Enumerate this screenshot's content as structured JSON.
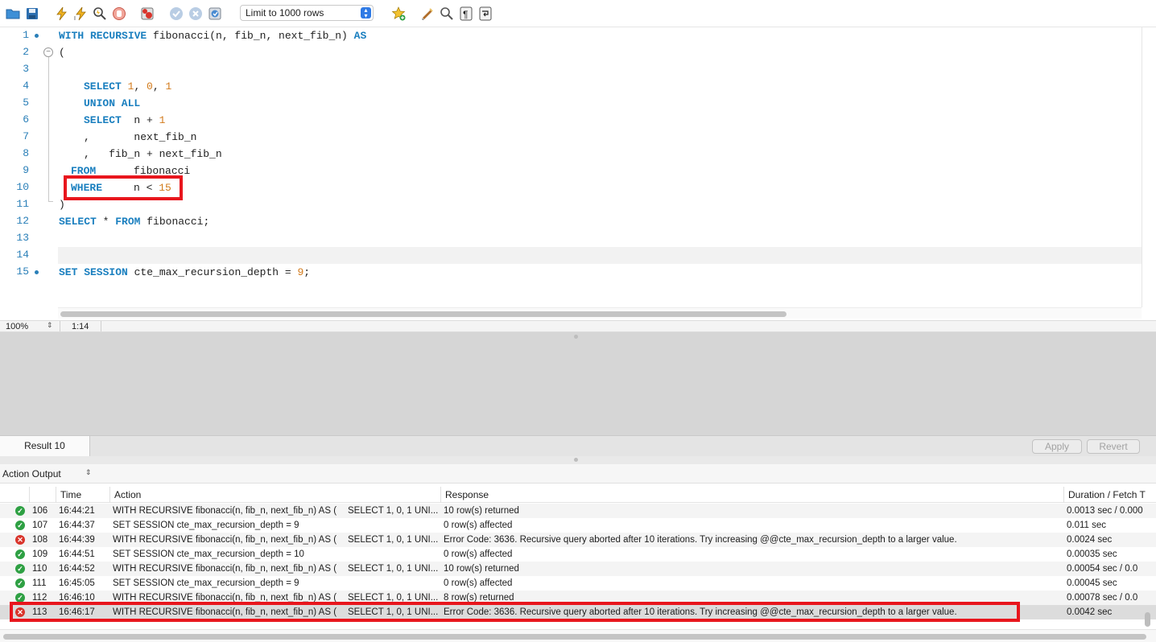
{
  "toolbar": {
    "icons": [
      "open-folder-icon",
      "save-icon",
      "execute-icon",
      "execute-current-icon",
      "explain-icon",
      "stop-icon",
      "toggle-error-icon",
      "commit-icon",
      "rollback-icon",
      "autocommit-icon",
      "add-snippet-icon",
      "beautify-icon",
      "find-icon",
      "invisible-chars-icon",
      "wrap-icon"
    ],
    "limit_label": "Limit to 1000 rows"
  },
  "editor": {
    "line_numbers": [
      "1",
      "2",
      "3",
      "4",
      "5",
      "6",
      "7",
      "8",
      "9",
      "10",
      "11",
      "12",
      "13",
      "14",
      "15"
    ],
    "lines": {
      "l1": {
        "kw1": "WITH RECURSIVE",
        "t1": " fibonacci(n, fib_n, next_fib_n) ",
        "kw2": "AS"
      },
      "l2": {
        "t1": "("
      },
      "l4": {
        "kw1": "SELECT",
        "n1": "1",
        "c1": ", ",
        "n2": "0",
        "c2": ", ",
        "n3": "1"
      },
      "l5": {
        "kw1": "UNION ALL"
      },
      "l6": {
        "kw1": "SELECT",
        "t1": "  n + ",
        "n1": "1"
      },
      "l7": {
        "t1": ",       next_fib_n"
      },
      "l8": {
        "t1": ",   fib_n + next_fib_n"
      },
      "l9": {
        "kw1": "FROM",
        "t1": "      fibonacci"
      },
      "l10": {
        "kw1": "WHERE",
        "t1": "     n < ",
        "n1": "15"
      },
      "l11": {
        "t1": ")"
      },
      "l12": {
        "kw1": "SELECT",
        "t1": " * ",
        "kw2": "FROM",
        "t2": " fibonacci;"
      },
      "l15": {
        "kw1": "SET SESSION",
        "t1": " cte_max_recursion_depth = ",
        "n1": "9",
        "t2": ";"
      }
    }
  },
  "status_bar": {
    "zoom": "100%",
    "cursor_position": "1:14"
  },
  "result_tabs": {
    "active_tab": "Result 10",
    "apply_label": "Apply",
    "revert_label": "Revert"
  },
  "output": {
    "selector_label": "Action Output",
    "columns": [
      "",
      "",
      "Time",
      "Action",
      "Response",
      "Duration / Fetch T"
    ],
    "rows": [
      {
        "status": "ok",
        "num": "106",
        "time": "16:44:21",
        "action": "WITH RECURSIVE fibonacci(n, fib_n, next_fib_n) AS (",
        "action2": "SELECT 1, 0, 1  UNI...",
        "response": "10 row(s) returned",
        "duration": "0.0013 sec / 0.000"
      },
      {
        "status": "ok",
        "num": "107",
        "time": "16:44:37",
        "action": "SET SESSION cte_max_recursion_depth = 9",
        "action2": "",
        "response": "0 row(s) affected",
        "duration": "0.011 sec"
      },
      {
        "status": "err",
        "num": "108",
        "time": "16:44:39",
        "action": "WITH RECURSIVE fibonacci(n, fib_n, next_fib_n) AS (",
        "action2": "SELECT 1, 0, 1  UNI...",
        "response": "Error Code: 3636. Recursive query aborted after 10 iterations. Try increasing @@cte_max_recursion_depth to a larger value.",
        "duration": "0.0024 sec"
      },
      {
        "status": "ok",
        "num": "109",
        "time": "16:44:51",
        "action": "SET SESSION cte_max_recursion_depth = 10",
        "action2": "",
        "response": "0 row(s) affected",
        "duration": "0.00035 sec"
      },
      {
        "status": "ok",
        "num": "110",
        "time": "16:44:52",
        "action": "WITH RECURSIVE fibonacci(n, fib_n, next_fib_n) AS (",
        "action2": "SELECT 1, 0, 1  UNI...",
        "response": "10 row(s) returned",
        "duration": "0.00054 sec / 0.0"
      },
      {
        "status": "ok",
        "num": "111",
        "time": "16:45:05",
        "action": "SET SESSION cte_max_recursion_depth = 9",
        "action2": "",
        "response": "0 row(s) affected",
        "duration": "0.00045 sec"
      },
      {
        "status": "ok",
        "num": "112",
        "time": "16:46:10",
        "action": "WITH RECURSIVE fibonacci(n, fib_n, next_fib_n) AS (",
        "action2": "SELECT 1, 0, 1  UNI...",
        "response": "8 row(s) returned",
        "duration": "0.00078 sec / 0.0"
      },
      {
        "status": "err",
        "num": "113",
        "time": "16:46:17",
        "action": "WITH RECURSIVE fibonacci(n, fib_n, next_fib_n) AS (",
        "action2": "SELECT 1, 0, 1  UNI...",
        "response": "Error Code: 3636. Recursive query aborted after 10 iterations. Try increasing @@cte_max_recursion_depth to a larger value.",
        "duration": "0.0042 sec"
      }
    ]
  },
  "colors": {
    "keyword": "#1a7fbf",
    "number": "#d27a1b",
    "highlight": "#e8161d",
    "ok": "#2ea043",
    "error": "#d9342b"
  }
}
